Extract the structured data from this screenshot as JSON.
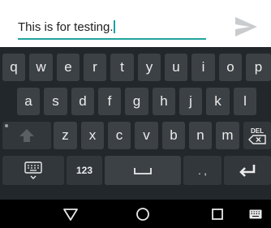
{
  "compose": {
    "message_text": "This is for testing.",
    "accent_color": "#20a49d",
    "send_icon": "send-arrow-icon"
  },
  "keyboard": {
    "row1": [
      "q",
      "w",
      "e",
      "r",
      "t",
      "y",
      "u",
      "i",
      "o",
      "p"
    ],
    "row2": [
      "a",
      "s",
      "d",
      "f",
      "g",
      "h",
      "j",
      "k",
      "l"
    ],
    "row3": [
      "z",
      "x",
      "c",
      "v",
      "b",
      "n",
      "m"
    ],
    "delete_label": "DEL",
    "symbols_label": "123",
    "punct_label": ". ,",
    "colors": {
      "background": "#22272b",
      "key": "#3c4145",
      "key_text": "#ececec"
    }
  },
  "navbar": {
    "back_icon": "back-triangle-icon",
    "home_icon": "home-circle-icon",
    "recents_icon": "recents-square-icon",
    "keyboard_icon": "keyboard-icon"
  }
}
